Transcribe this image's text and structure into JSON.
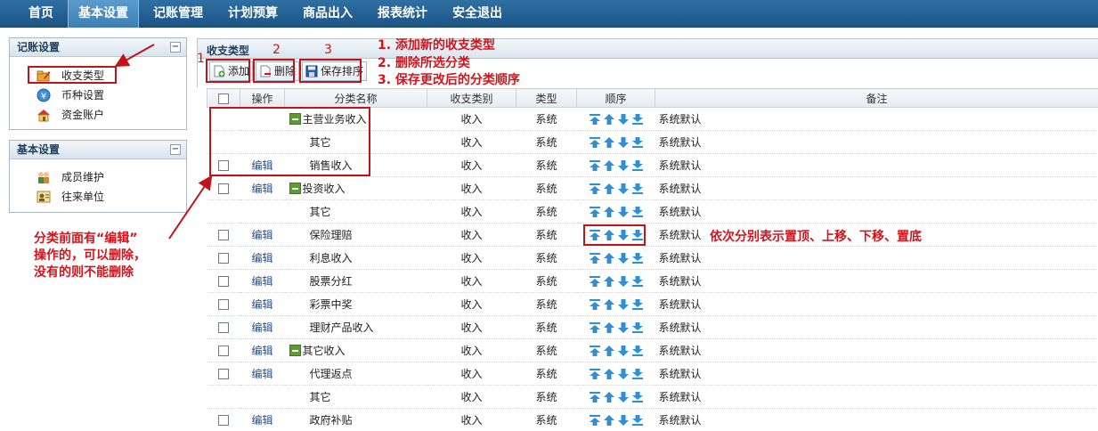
{
  "nav": [
    {
      "label": "首页"
    },
    {
      "label": "基本设置",
      "active": true
    },
    {
      "label": "记账管理"
    },
    {
      "label": "计划预算"
    },
    {
      "label": "商品出入"
    },
    {
      "label": "报表统计"
    },
    {
      "label": "安全退出"
    }
  ],
  "sidebar": {
    "bookkeeping": {
      "title": "记账设置",
      "items": [
        {
          "label": "收支类型",
          "icon": "folder-pencil-icon"
        },
        {
          "label": "币种设置",
          "icon": "yen-coin-icon"
        },
        {
          "label": "资金账户",
          "icon": "house-icon"
        }
      ]
    },
    "basic": {
      "title": "基本设置",
      "items": [
        {
          "label": "成员维护",
          "icon": "members-icon"
        },
        {
          "label": "往来单位",
          "icon": "contacts-icon"
        }
      ]
    }
  },
  "main": {
    "title": "收支类型",
    "toolbar": {
      "add_label": "添加",
      "delete_label": "删除",
      "save_order_label": "保存排序"
    },
    "columns": [
      "操作",
      "分类名称",
      "收支类别",
      "类型",
      "顺序",
      "备注"
    ],
    "edit_label": "编辑",
    "rows": [
      {
        "checkbox": false,
        "edit": false,
        "name": "主营业务收入",
        "group": true,
        "direction": "收入",
        "kind": "系统",
        "remark": "系统默认"
      },
      {
        "checkbox": false,
        "edit": false,
        "name": "其它",
        "group": false,
        "direction": "收入",
        "kind": "系统",
        "remark": "系统默认"
      },
      {
        "checkbox": true,
        "edit": true,
        "name": "销售收入",
        "group": false,
        "direction": "收入",
        "kind": "系统",
        "remark": "系统默认"
      },
      {
        "checkbox": true,
        "edit": true,
        "name": "投资收入",
        "group": true,
        "direction": "收入",
        "kind": "系统",
        "remark": "系统默认"
      },
      {
        "checkbox": false,
        "edit": false,
        "name": "其它",
        "group": false,
        "direction": "收入",
        "kind": "系统",
        "remark": "系统默认"
      },
      {
        "checkbox": true,
        "edit": true,
        "name": "保险理赔",
        "group": false,
        "direction": "收入",
        "kind": "系统",
        "remark": "系统默认"
      },
      {
        "checkbox": true,
        "edit": true,
        "name": "利息收入",
        "group": false,
        "direction": "收入",
        "kind": "系统",
        "remark": "系统默认"
      },
      {
        "checkbox": true,
        "edit": true,
        "name": "股票分红",
        "group": false,
        "direction": "收入",
        "kind": "系统",
        "remark": "系统默认"
      },
      {
        "checkbox": true,
        "edit": true,
        "name": "彩票中奖",
        "group": false,
        "direction": "收入",
        "kind": "系统",
        "remark": "系统默认"
      },
      {
        "checkbox": true,
        "edit": true,
        "name": "理财产品收入",
        "group": false,
        "direction": "收入",
        "kind": "系统",
        "remark": "系统默认"
      },
      {
        "checkbox": true,
        "edit": true,
        "name": "其它收入",
        "group": true,
        "direction": "收入",
        "kind": "系统",
        "remark": "系统默认"
      },
      {
        "checkbox": true,
        "edit": true,
        "name": "代理返点",
        "group": false,
        "direction": "收入",
        "kind": "系统",
        "remark": "系统默认"
      },
      {
        "checkbox": false,
        "edit": false,
        "name": "其它",
        "group": false,
        "direction": "收入",
        "kind": "系统",
        "remark": "系统默认"
      },
      {
        "checkbox": true,
        "edit": true,
        "name": "政府补贴",
        "group": false,
        "direction": "收入",
        "kind": "系统",
        "remark": "系统默认"
      }
    ]
  },
  "annotations": {
    "num1": "1",
    "num2": "2",
    "num3": "3",
    "note1": "1. 添加新的收支类型",
    "note2": "2. 删除所选分类",
    "note3": "3. 保存更改后的分类顺序",
    "order_note": "依次分别表示置顶、上移、下移、置底",
    "edit_note_1": "分类前面有“编辑”",
    "edit_note_2": "操作的，可以删除，",
    "edit_note_3": "没有的则不能删除"
  },
  "colors": {
    "nav": "#1d5486",
    "annotation": "#d2141c",
    "arrow_icon": "#2f8fd6",
    "group_marker": "#5c9e2e"
  }
}
